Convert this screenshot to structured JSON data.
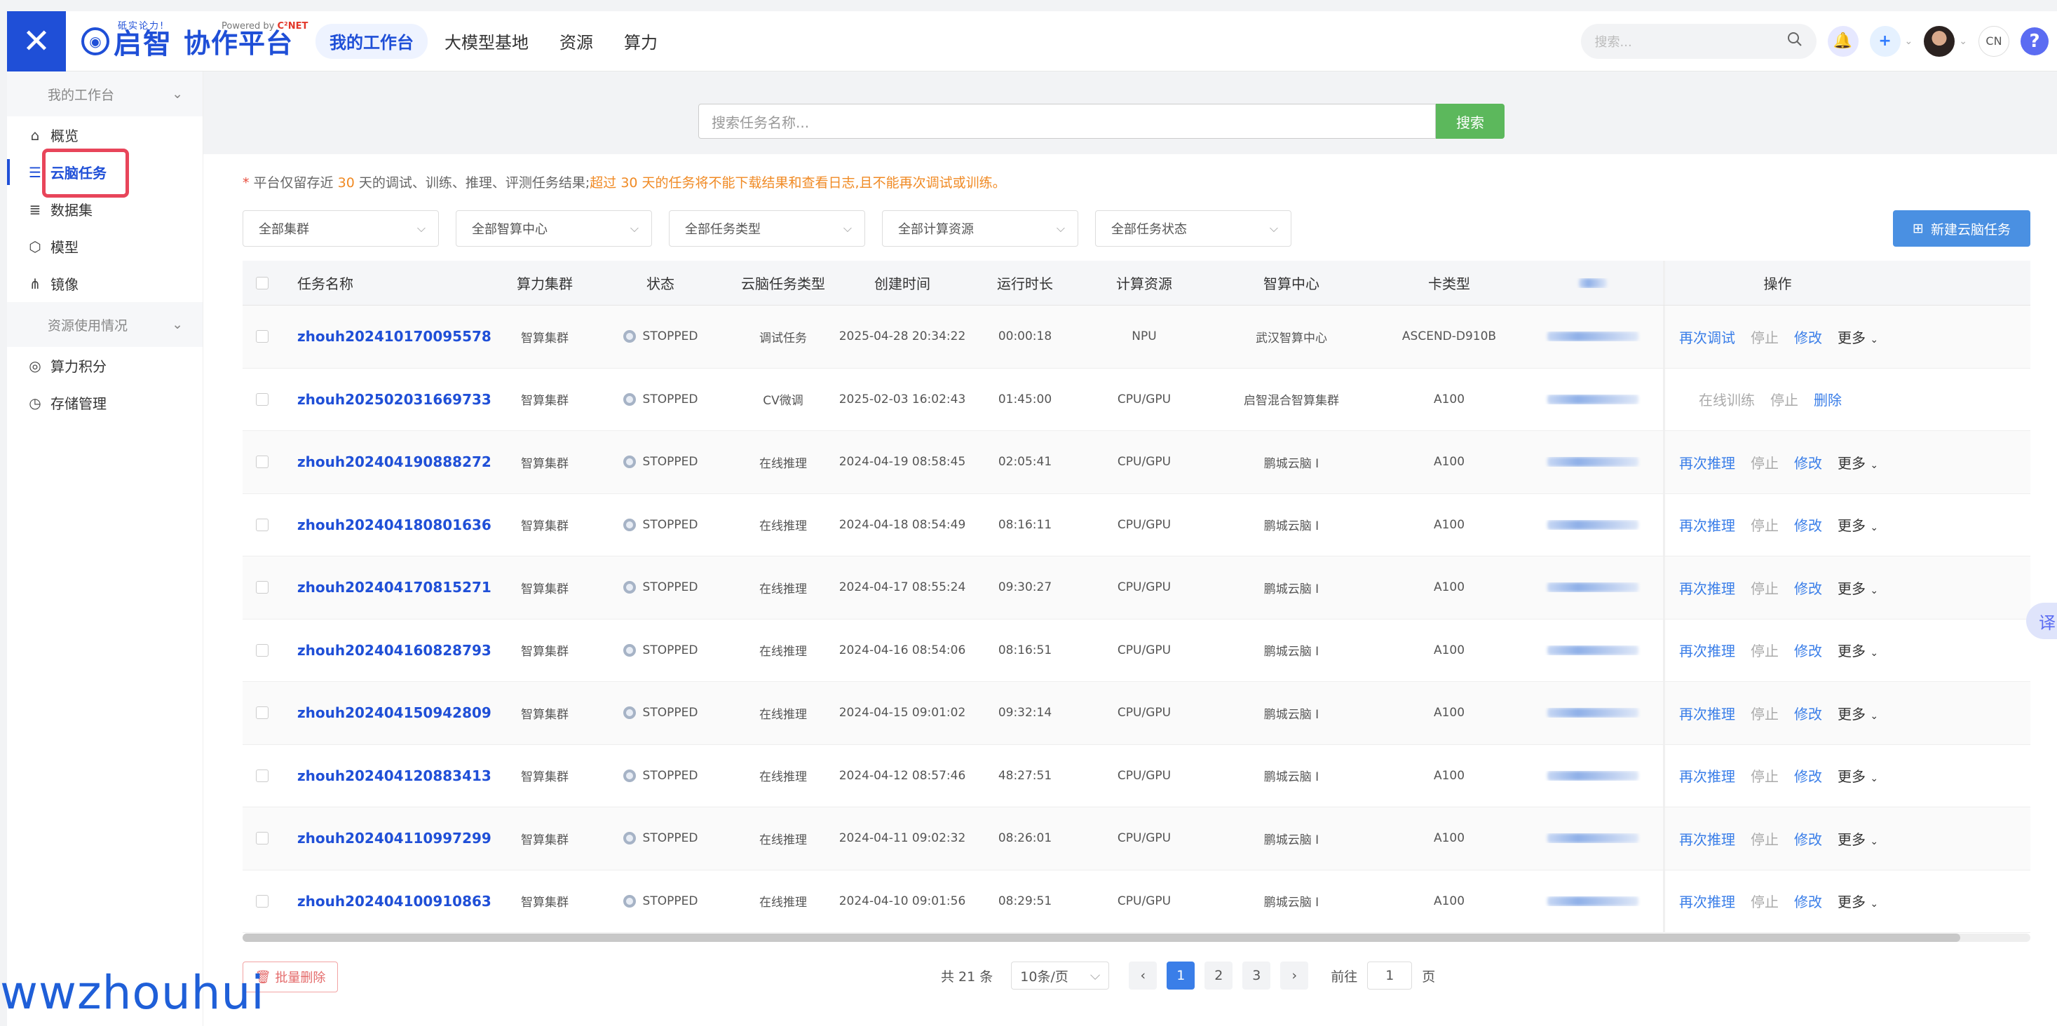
{
  "header": {
    "logo_tagline": "砥实论力!",
    "logo_name": "启智",
    "logo_platform": "协作平台",
    "powered_prefix": "Powered by",
    "powered_brand": "C²NET",
    "nav": [
      "我的工作台",
      "大模型基地",
      "资源",
      "算力"
    ],
    "search_placeholder": "搜索...",
    "lang": "CN",
    "help": "?"
  },
  "sidebar": {
    "group1": "我的工作台",
    "items1": [
      {
        "label": "概览",
        "icon": "home-icon"
      },
      {
        "label": "云脑任务",
        "icon": "task-list-icon"
      },
      {
        "label": "数据集",
        "icon": "database-icon"
      },
      {
        "label": "模型",
        "icon": "model-cube-icon"
      },
      {
        "label": "镜像",
        "icon": "image-mirror-icon"
      }
    ],
    "group2": "资源使用情况",
    "items2": [
      {
        "label": "算力积分",
        "icon": "points-icon"
      },
      {
        "label": "存储管理",
        "icon": "storage-icon"
      }
    ]
  },
  "search": {
    "placeholder": "搜索任务名称...",
    "button": "搜索"
  },
  "notice": {
    "part1": "平台仅留存近",
    "num1": "30",
    "part2": "天的调试、训练、推理、评测任务结果;",
    "warn1": "超过",
    "num2": "30",
    "warn2": "天的任务将不能下载结果和查看日志,且不能再次调试或训练。"
  },
  "filters": [
    "全部集群",
    "全部智算中心",
    "全部任务类型",
    "全部计算资源",
    "全部任务状态"
  ],
  "new_task_button": "新建云脑任务",
  "table": {
    "columns": [
      "任务名称",
      "算力集群",
      "状态",
      "云脑任务类型",
      "创建时间",
      "运行时长",
      "计算资源",
      "智算中心",
      "卡类型",
      "",
      "操作"
    ],
    "rows": [
      {
        "name": "zhouh202410170095578",
        "cluster": "智算集群",
        "status": "STOPPED",
        "type": "调试任务",
        "created": "2025-04-28 20:34:22",
        "duration": "00:00:18",
        "resource": "NPU",
        "center": "武汉智算中心",
        "card": "ASCEND-D910B",
        "ops": [
          "再次调试",
          "停止",
          "修改",
          "更多"
        ]
      },
      {
        "name": "zhouh202502031669733",
        "cluster": "智算集群",
        "status": "STOPPED",
        "type": "CV微调",
        "created": "2025-02-03 16:02:43",
        "duration": "01:45:00",
        "resource": "CPU/GPU",
        "center": "启智混合智算集群",
        "card": "A100",
        "ops": [
          "在线训练",
          "停止",
          "删除"
        ]
      },
      {
        "name": "zhouh202404190888272",
        "cluster": "智算集群",
        "status": "STOPPED",
        "type": "在线推理",
        "created": "2024-04-19 08:58:45",
        "duration": "02:05:41",
        "resource": "CPU/GPU",
        "center": "鹏城云脑 I",
        "card": "A100",
        "ops": [
          "再次推理",
          "停止",
          "修改",
          "更多"
        ]
      },
      {
        "name": "zhouh202404180801636",
        "cluster": "智算集群",
        "status": "STOPPED",
        "type": "在线推理",
        "created": "2024-04-18 08:54:49",
        "duration": "08:16:11",
        "resource": "CPU/GPU",
        "center": "鹏城云脑 I",
        "card": "A100",
        "ops": [
          "再次推理",
          "停止",
          "修改",
          "更多"
        ]
      },
      {
        "name": "zhouh202404170815271",
        "cluster": "智算集群",
        "status": "STOPPED",
        "type": "在线推理",
        "created": "2024-04-17 08:55:24",
        "duration": "09:30:27",
        "resource": "CPU/GPU",
        "center": "鹏城云脑 I",
        "card": "A100",
        "ops": [
          "再次推理",
          "停止",
          "修改",
          "更多"
        ]
      },
      {
        "name": "zhouh202404160828793",
        "cluster": "智算集群",
        "status": "STOPPED",
        "type": "在线推理",
        "created": "2024-04-16 08:54:06",
        "duration": "08:16:51",
        "resource": "CPU/GPU",
        "center": "鹏城云脑 I",
        "card": "A100",
        "ops": [
          "再次推理",
          "停止",
          "修改",
          "更多"
        ]
      },
      {
        "name": "zhouh202404150942809",
        "cluster": "智算集群",
        "status": "STOPPED",
        "type": "在线推理",
        "created": "2024-04-15 09:01:02",
        "duration": "09:32:14",
        "resource": "CPU/GPU",
        "center": "鹏城云脑 I",
        "card": "A100",
        "ops": [
          "再次推理",
          "停止",
          "修改",
          "更多"
        ]
      },
      {
        "name": "zhouh202404120883413",
        "cluster": "智算集群",
        "status": "STOPPED",
        "type": "在线推理",
        "created": "2024-04-12 08:57:46",
        "duration": "48:27:51",
        "resource": "CPU/GPU",
        "center": "鹏城云脑 I",
        "card": "A100",
        "ops": [
          "再次推理",
          "停止",
          "修改",
          "更多"
        ]
      },
      {
        "name": "zhouh202404110997299",
        "cluster": "智算集群",
        "status": "STOPPED",
        "type": "在线推理",
        "created": "2024-04-11 09:02:32",
        "duration": "08:26:01",
        "resource": "CPU/GPU",
        "center": "鹏城云脑 I",
        "card": "A100",
        "ops": [
          "再次推理",
          "停止",
          "修改",
          "更多"
        ]
      },
      {
        "name": "zhouh202404100910863",
        "cluster": "智算集群",
        "status": "STOPPED",
        "type": "在线推理",
        "created": "2024-04-10 09:01:56",
        "duration": "08:29:51",
        "resource": "CPU/GPU",
        "center": "鹏城云脑 I",
        "card": "A100",
        "ops": [
          "再次推理",
          "停止",
          "修改",
          "更多"
        ]
      }
    ]
  },
  "footer": {
    "batch_delete": "批量删除",
    "total": "共 21 条",
    "page_size": "10条/页",
    "pages": [
      "1",
      "2",
      "3"
    ],
    "current_page": "1",
    "goto_label": "前往",
    "goto_value": "1",
    "goto_suffix": "页"
  },
  "side_tab": "译",
  "watermark": "wwzhouhui",
  "colors": {
    "primary": "#1f4fd7",
    "link": "#3a7ee8",
    "search_button": "#5cb85c",
    "highlight": "#e8455a",
    "warning": "#f08a24"
  }
}
